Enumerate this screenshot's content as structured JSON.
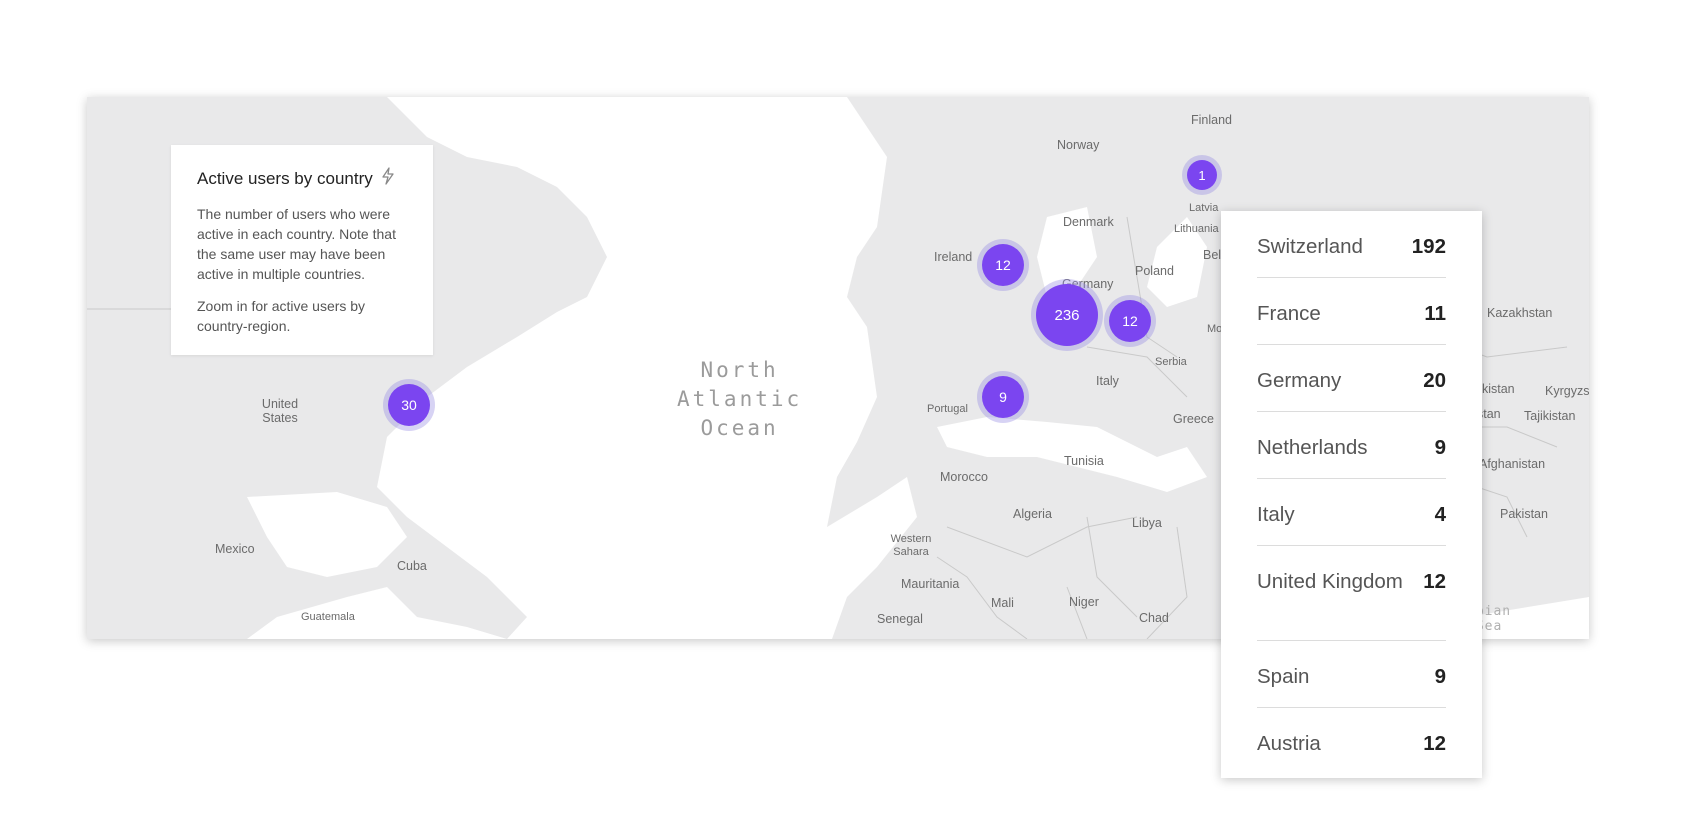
{
  "card": {
    "title": "Active users by country",
    "description": "The number of users who were active in each country. Note that the same user may have been active in multiple countries.",
    "zoom_hint": "Zoom in for active users by country-region.",
    "icon": "lightning-icon"
  },
  "map": {
    "ocean_label": [
      "North",
      "Atlantic",
      "Ocean"
    ],
    "sea_label": [
      "abian",
      "Sea"
    ],
    "place_labels": {
      "finland": "Finland",
      "norway": "Norway",
      "latvia": "Latvia",
      "lithuania": "Lithuania",
      "denmark": "Denmark",
      "ireland": "Ireland",
      "poland": "Poland",
      "germany": "Germany",
      "bel": "Bel",
      "mo": "Mo",
      "kazakhstan": "Kazakhstan",
      "serbia": "Serbia",
      "italy": "Italy",
      "portugal": "Portugal",
      "united_states": "United States",
      "greece": "Greece",
      "ekistan": "ekistan",
      "kyrgyz": "Kyrgyzs",
      "stan": "stan",
      "tajikistan": "Tajikistan",
      "tunisia": "Tunisia",
      "morocco": "Morocco",
      "afghanistan": "Afghanistan",
      "algeria": "Algeria",
      "libya": "Libya",
      "pakistan": "Pakistan",
      "mexico": "Mexico",
      "western_sahara": "Western Sahara",
      "cuba": "Cuba",
      "mauritania": "Mauritania",
      "mali": "Mali",
      "niger": "Niger",
      "guatemala": "Guatemala",
      "senegal": "Senegal",
      "chad": "Chad"
    },
    "markers": {
      "usa": "30",
      "uk": "12",
      "france": "236",
      "central": "12",
      "spain": "9",
      "north": "1"
    },
    "colors": {
      "land": "#e9e9ea",
      "ocean": "#ffffff",
      "marker": "#7b45f0",
      "border": "#c9c9c9"
    }
  },
  "countries": [
    {
      "name": "Switzerland",
      "value": "192"
    },
    {
      "name": "France",
      "value": "11"
    },
    {
      "name": "Germany",
      "value": "20"
    },
    {
      "name": "Netherlands",
      "value": "9"
    },
    {
      "name": "Italy",
      "value": "4"
    },
    {
      "name": "United Kingdom",
      "value": "12"
    },
    {
      "name": "Spain",
      "value": "9"
    },
    {
      "name": "Austria",
      "value": "12"
    }
  ]
}
